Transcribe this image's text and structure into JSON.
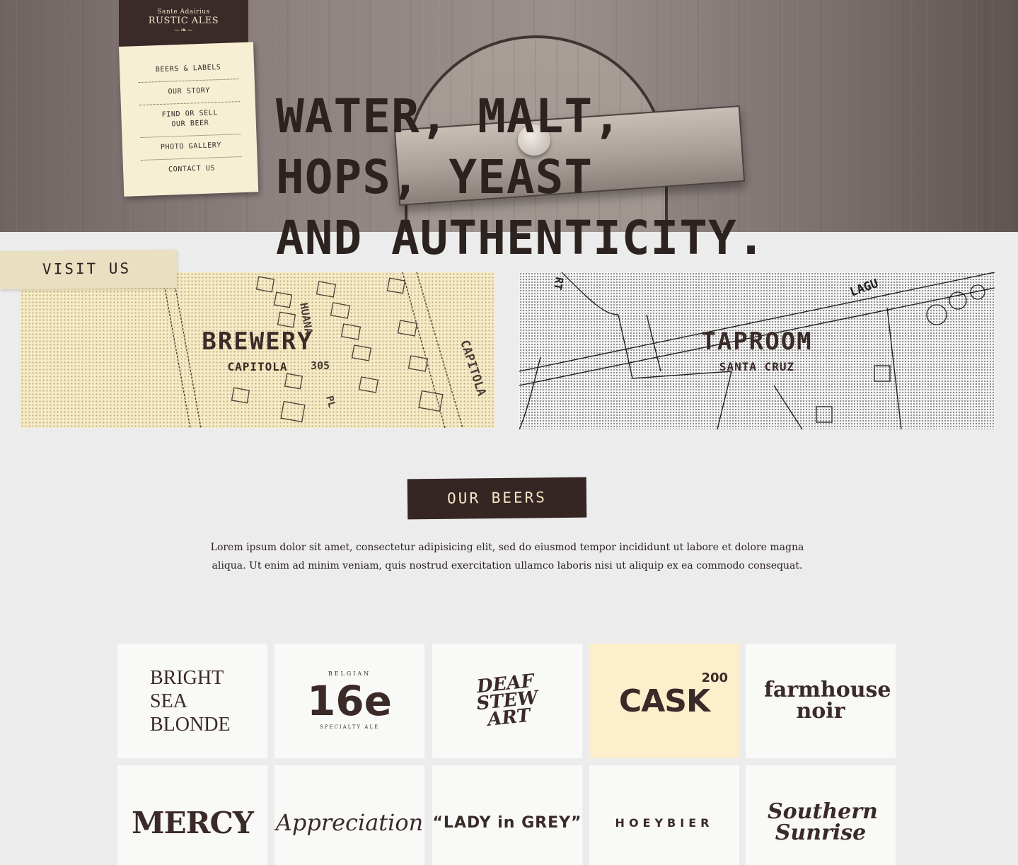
{
  "logo": {
    "line1": "Sante Adairius",
    "line2": "RUSTIC ALES",
    "swirl": "~❧~"
  },
  "nav": {
    "items": [
      {
        "label": "BEERS & LABELS"
      },
      {
        "label": "OUR STORY"
      },
      {
        "label": "FIND OR SELL OUR BEER"
      },
      {
        "label": "PHOTO GALLERY"
      },
      {
        "label": "CONTACT US"
      }
    ]
  },
  "hero": {
    "line1": "WATER, MALT,",
    "line2": "HOPS, YEAST",
    "line3": "AND AUTHENTICITY."
  },
  "visit": {
    "tag": "VISIT US",
    "brewery": {
      "title": "BREWERY",
      "subtitle": "CAPITOLA"
    },
    "taproom": {
      "title": "TAPROOM",
      "subtitle": "SANTA CRUZ"
    },
    "map_text": {
      "huana": "HUANA",
      "number": "305",
      "capitola": "CAPITOLA",
      "pl": "PL",
      "laguna": "LAGU",
      "rt": "RT"
    }
  },
  "beers": {
    "button": "OUR BEERS",
    "intro": "Lorem ipsum dolor sit amet, consectetur adipisicing elit, sed do eiusmod tempor incididunt ut labore et dolore magna aliqua. Ut enim ad minim veniam, quis nostrud exercitation ullamco laboris nisi ut aliquip ex ea commodo consequat.",
    "tiles": {
      "bright": "BRIGHT SEA BLONDE",
      "sixteen_top": "BELGIAN",
      "sixteen": "16e",
      "sixteen_bottom": "SPECIALTY ALE",
      "deaf": "DEAF STEW ART",
      "cask": "CASK",
      "cask_sup": "200",
      "farmhouse": "farmhouse noir",
      "mercy": "MERCY",
      "appreciation": "Appreciation",
      "lady": "“LADY in GREY”",
      "hoeybier": "HOEYBIER",
      "southern": "Southern Sunrise"
    }
  },
  "colors": {
    "dark_brown": "#352624",
    "cream": "#f6efd4",
    "highlight": "#fdefcc"
  }
}
